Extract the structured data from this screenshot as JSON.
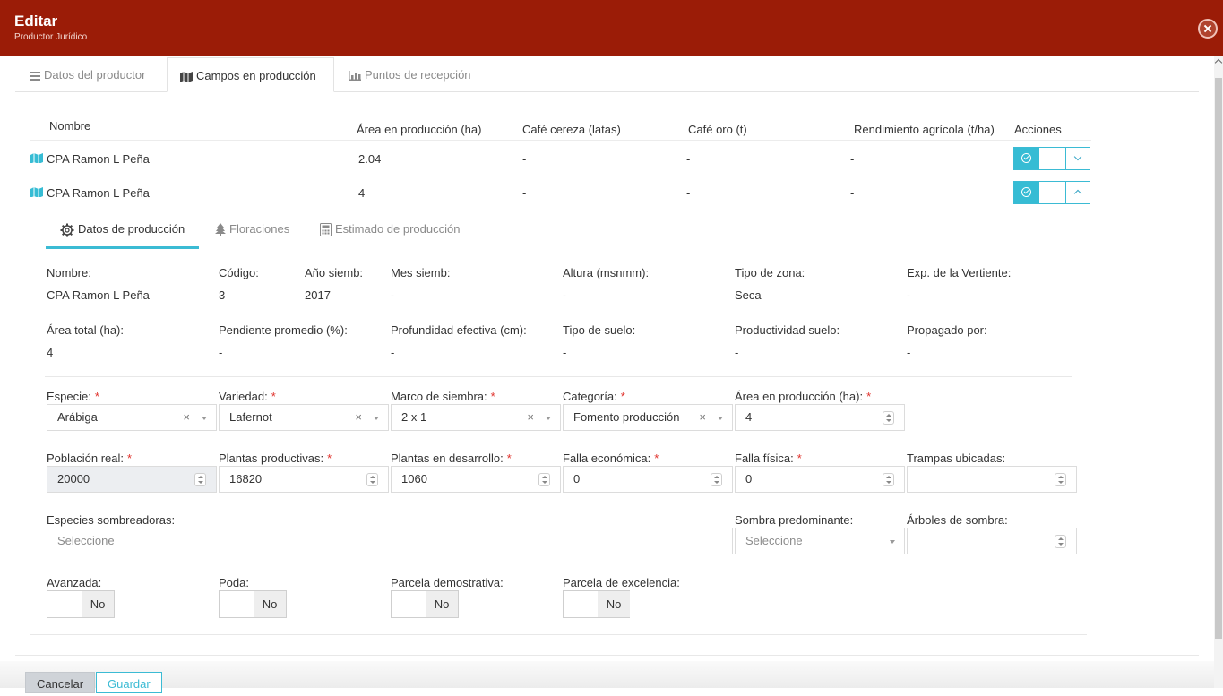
{
  "header": {
    "title": "Editar",
    "subtitle": "Productor Jurídico"
  },
  "tabs": [
    {
      "label": "Datos del productor",
      "icon": "list-icon"
    },
    {
      "label": "Campos en producción",
      "icon": "map-icon"
    },
    {
      "label": "Puntos de recepción",
      "icon": "bar-chart-icon"
    }
  ],
  "table": {
    "headers": [
      "Nombre",
      "Área en producción (ha)",
      "Café cereza (latas)",
      "Café oro (t)",
      "Rendimiento agrícola (t/ha)",
      "Acciones"
    ],
    "rows": [
      {
        "nombre": "CPA Ramon L Peña",
        "area": "2.04",
        "cereza": "-",
        "oro": "-",
        "rendimiento": "-"
      },
      {
        "nombre": "CPA Ramon L Peña",
        "area": "4",
        "cereza": "-",
        "oro": "-",
        "rendimiento": "-"
      }
    ]
  },
  "subtabs": [
    {
      "label": "Datos de producción",
      "icon": "gear-icon"
    },
    {
      "label": "Floraciones",
      "icon": "tree-icon"
    },
    {
      "label": "Estimado de producción",
      "icon": "calculator-icon"
    }
  ],
  "info": {
    "row1": [
      {
        "label": "Nombre:",
        "value": "CPA Ramon L Peña"
      },
      {
        "label": "Código:",
        "value": "3"
      },
      {
        "label": "Año siemb:",
        "value": "2017"
      },
      {
        "label": "Mes siemb:",
        "value": "-"
      },
      {
        "label": "Altura (msnmm):",
        "value": "-"
      },
      {
        "label": "Tipo de zona:",
        "value": "Seca"
      },
      {
        "label": "Exp. de la Vertiente:",
        "value": "-"
      }
    ],
    "row2": [
      {
        "label": "Área total (ha):",
        "value": "4"
      },
      {
        "label": "Pendiente promedio (%):",
        "value": "-"
      },
      {
        "label": "Profundidad efectiva (cm):",
        "value": "-"
      },
      {
        "label": "Tipo de suelo:",
        "value": "-"
      },
      {
        "label": "Productividad suelo:",
        "value": "-"
      },
      {
        "label": "Propagado por:",
        "value": "-"
      }
    ]
  },
  "form": {
    "especie": {
      "label": "Especie:",
      "value": "Arábiga"
    },
    "variedad": {
      "label": "Variedad:",
      "value": "Lafernot"
    },
    "marco": {
      "label": "Marco de siembra:",
      "value": "2 x 1"
    },
    "categoria": {
      "label": "Categoría:",
      "value": "Fomento producción"
    },
    "area_prod": {
      "label": "Área en producción (ha):",
      "value": "4"
    },
    "poblacion": {
      "label": "Población real:",
      "value": "20000"
    },
    "productivas": {
      "label": "Plantas productivas:",
      "value": "16820"
    },
    "desarrollo": {
      "label": "Plantas en desarrollo:",
      "value": "1060"
    },
    "falla_eco": {
      "label": "Falla económica:",
      "value": "0"
    },
    "falla_fis": {
      "label": "Falla física:",
      "value": "0"
    },
    "trampas": {
      "label": "Trampas ubicadas:",
      "value": ""
    },
    "sombreadoras": {
      "label": "Especies sombreadoras:",
      "placeholder": "Seleccione"
    },
    "sombra": {
      "label": "Sombra predominante:",
      "placeholder": "Seleccione"
    },
    "arboles": {
      "label": "Árboles de sombra:",
      "value": ""
    },
    "avanzada": {
      "label": "Avanzada:",
      "state": "No"
    },
    "poda": {
      "label": "Poda:",
      "state": "No"
    },
    "demostrativa": {
      "label": "Parcela demostrativa:",
      "state": "No"
    },
    "excelencia": {
      "label": "Parcela de excelencia:",
      "state": "No"
    }
  },
  "footer": {
    "cancel": "Cancelar",
    "save": "Guardar"
  },
  "colors": {
    "header": "#9b1c07",
    "accent": "#3bbbd4",
    "required": "#e0312b"
  }
}
